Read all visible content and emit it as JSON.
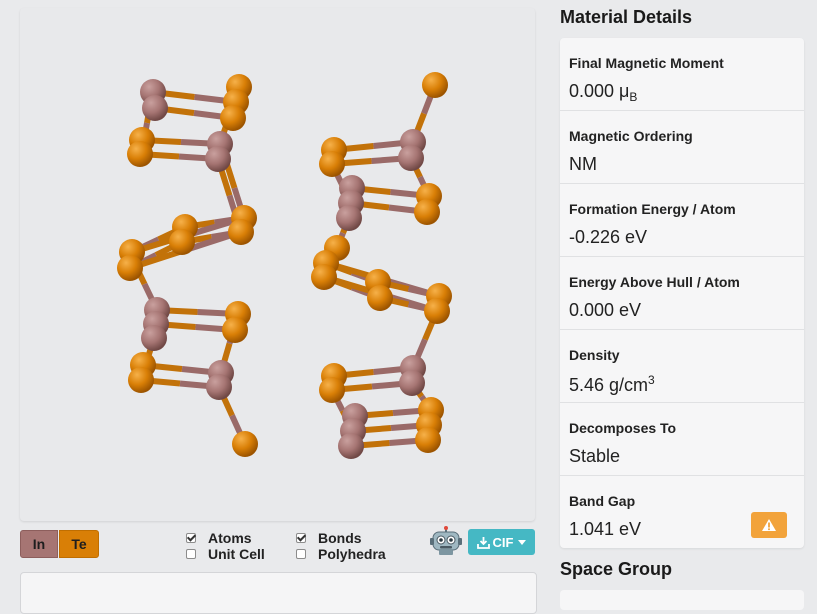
{
  "legend": {
    "in_label": "In",
    "te_label": "Te"
  },
  "options": {
    "atoms": {
      "label": "Atoms",
      "checked": true
    },
    "unit_cell": {
      "label": "Unit Cell",
      "checked": false
    },
    "bonds": {
      "label": "Bonds",
      "checked": true
    },
    "polyhedra": {
      "label": "Polyhedra",
      "checked": false
    }
  },
  "download": {
    "label": "CIF"
  },
  "material_details": {
    "title": "Material Details",
    "rows": [
      {
        "label": "Final Magnetic Moment",
        "value": "0.000 μ",
        "unit_sub": "B"
      },
      {
        "label": "Magnetic Ordering",
        "value": "NM"
      },
      {
        "label": "Formation Energy / Atom",
        "value": "-0.226 eV"
      },
      {
        "label": "Energy Above Hull / Atom",
        "value": "0.000 eV"
      },
      {
        "label": "Density",
        "value": "5.46 g/cm",
        "unit_sup": "3"
      },
      {
        "label": "Decomposes To",
        "value": "Stable"
      },
      {
        "label": "Band Gap",
        "value": "1.041 eV"
      }
    ]
  },
  "space_group": {
    "title": "Space Group"
  },
  "colors": {
    "in_atom": "#a67573",
    "te_atom": "#d97f06",
    "accent": "#45b8c4",
    "warning": "#f2a33b"
  },
  "icons": [
    "robot-icon",
    "download-icon",
    "warning-icon"
  ]
}
